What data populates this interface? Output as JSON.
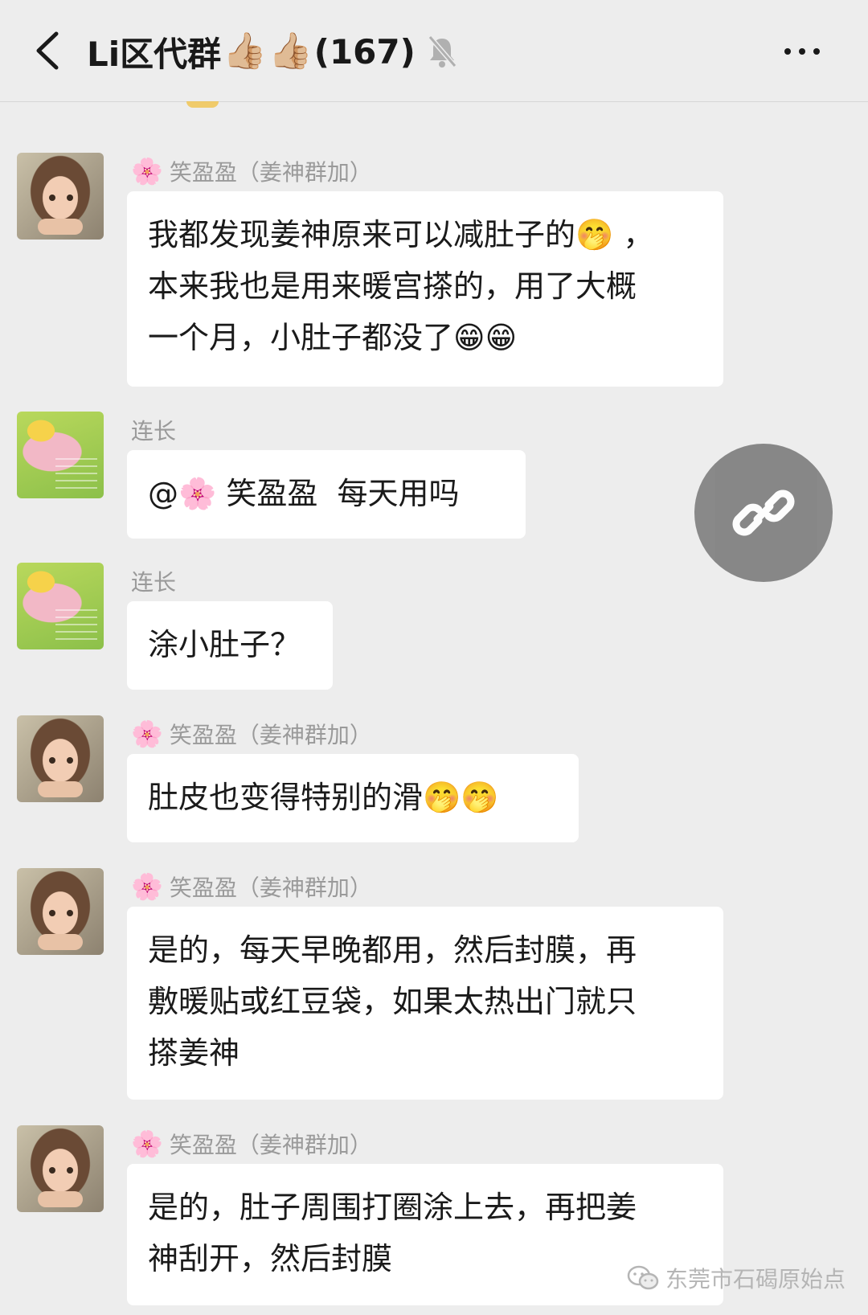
{
  "header": {
    "title_prefix": "Li区代群",
    "title_emoji_1": "👍🏼",
    "title_emoji_2": "👍🏼",
    "member_count": "(167)"
  },
  "messages": [
    {
      "sender": "笑盈盈（姜神群加）",
      "avatar": "girl",
      "text": "我都发现姜神原来可以减肚子的🤭 ，\n本来我也是用来暖宫搽的，用了大概\n一个月，小肚子都没了😁😁"
    },
    {
      "sender": "连长",
      "avatar": "flower",
      "text": "@🌸 笑盈盈  每天用吗"
    },
    {
      "sender": "连长",
      "avatar": "flower",
      "text": "涂小肚子？"
    },
    {
      "sender": "笑盈盈（姜神群加）",
      "avatar": "girl",
      "text": "肚皮也变得特别的滑🤭🤭"
    },
    {
      "sender": "笑盈盈（姜神群加）",
      "avatar": "girl",
      "text": "是的，每天早晚都用，然后封膜，再\n敷暖贴或红豆袋，如果太热出门就只\n搽姜神"
    },
    {
      "sender": "笑盈盈（姜神群加）",
      "avatar": "girl",
      "text": "是的，肚子周围打圈涂上去，再把姜\n神刮开，然后封膜"
    }
  ],
  "watermark": {
    "text": "东莞市石碣原始点"
  },
  "icons": {
    "back": "chevron-left-icon",
    "mute": "bell-muted-icon",
    "more": "more-dots-icon",
    "link": "link-icon",
    "blossom": "cherry-blossom-icon",
    "wechat": "wechat-icon"
  }
}
